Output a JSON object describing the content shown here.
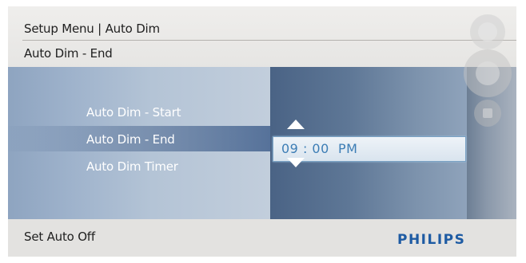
{
  "header": {
    "title": "Setup Menu | Auto Dim",
    "subtitle": "Auto Dim - End"
  },
  "menu": {
    "items": [
      {
        "label": "Auto Dim - Start"
      },
      {
        "label": "Auto Dim - End",
        "selected": true
      },
      {
        "label": "Auto Dim Timer"
      }
    ]
  },
  "time_setting": {
    "value": "09 : 00  PM"
  },
  "icons": {
    "up": "up-arrow-icon",
    "down": "down-arrow-icon",
    "deco": "control-buttons-icon"
  },
  "footer": {
    "label": "Set Auto Off",
    "brand": "PHILIPS"
  },
  "colors": {
    "brand": "#1e5ba3",
    "time_text": "#3c7db5",
    "highlight": "#56729a"
  }
}
